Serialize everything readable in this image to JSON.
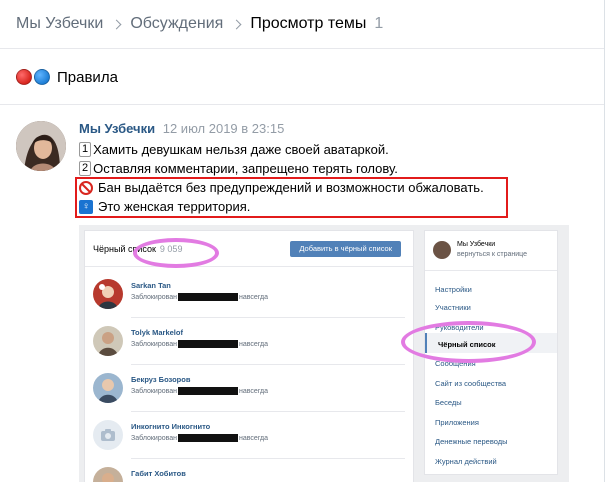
{
  "breadcrumb": {
    "group": "Мы Узбечки",
    "section": "Обсуждения",
    "current": "Просмотр темы",
    "count": "1"
  },
  "pinned": {
    "label": "Правила"
  },
  "post": {
    "author": "Мы Узбечки",
    "date": "12 июл 2019 в 23:15",
    "line1_num": "1",
    "line1": "Хамить девушкам нельзя даже своей аватаркой.",
    "line2_num": "2",
    "line2": "Оставляя комментарии, запрещено терять голову.",
    "line3": "Бан выдаётся без предупреждений и возможности обжаловать.",
    "line4": "Это женская территория."
  },
  "embedded": {
    "title": "Чёрный список",
    "count": "9 059",
    "add_button": "Добавить в чёрный список",
    "rows": [
      {
        "name": "Sarkan Tan",
        "status_prefix": "Заблокирован",
        "status_suffix": "навсегда"
      },
      {
        "name": "Tolyk Markelof",
        "status_prefix": "Заблокирован",
        "status_suffix": "навсегда"
      },
      {
        "name": "Бекруз Бозоров",
        "status_prefix": "Заблокирован",
        "status_suffix": "навсегда"
      },
      {
        "name": "Инкогнито Инкогнито",
        "status_prefix": "Заблокирован",
        "status_suffix": "навсегда"
      },
      {
        "name": "Габит Хобитов"
      }
    ],
    "side": {
      "name": "Мы Узбечки",
      "back": "вернуться к странице",
      "menu": [
        "Настройки",
        "Участники",
        "Руководители",
        "Чёрный список",
        "Сообщения",
        "Сайт из сообщества",
        "Беседы",
        "Приложения",
        "Денежные переводы",
        "Журнал действий"
      ]
    }
  },
  "colors": {
    "link": "#2a5885",
    "accent_button": "#5181b8",
    "highlight_box": "#e21b1b",
    "marker": "#e27be2"
  }
}
